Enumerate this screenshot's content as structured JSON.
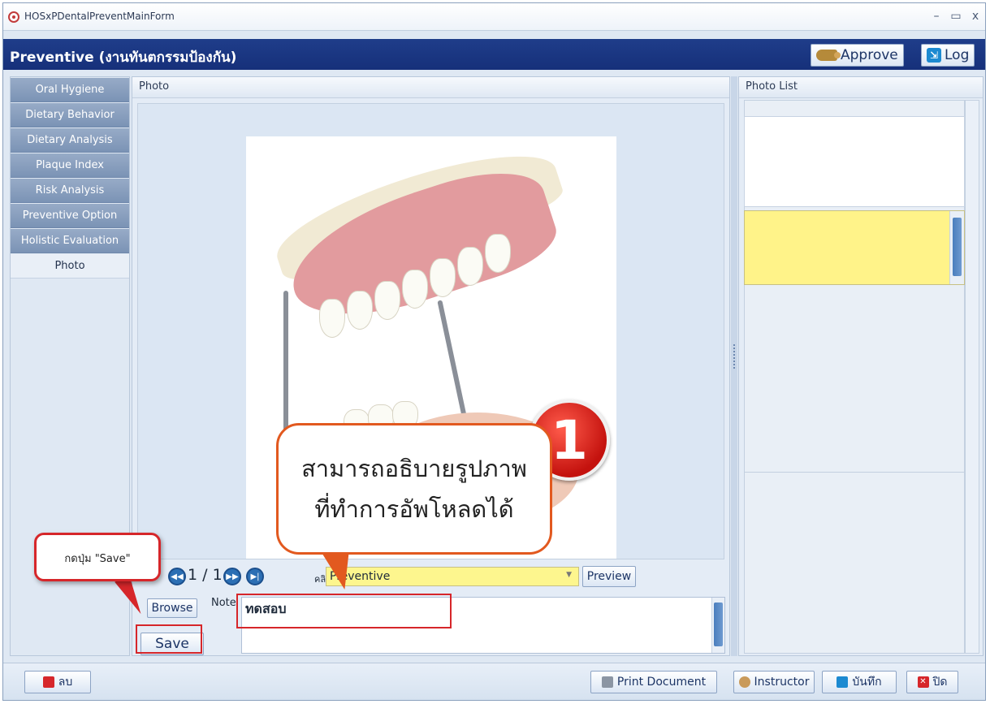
{
  "window": {
    "title": "HOSxPDentalPreventMainForm",
    "controls": [
      "–",
      "▭",
      "x"
    ]
  },
  "header": {
    "title": "Preventive (งานทันตกรรมป้องกัน)",
    "approve_label": "Approve",
    "log_label": "Log"
  },
  "sidebar": {
    "items": [
      {
        "label": "Oral Hygiene"
      },
      {
        "label": "Dietary Behavior"
      },
      {
        "label": "Dietary Analysis"
      },
      {
        "label": "Plaque Index"
      },
      {
        "label": "Risk Analysis"
      },
      {
        "label": "Preventive Option"
      },
      {
        "label": "Holistic Evaluation"
      },
      {
        "label": "Photo"
      }
    ],
    "active_index": 7
  },
  "photo_panel": {
    "header": "Photo",
    "page_indicator": "1 / 1",
    "clinic_label": "คลินิก",
    "clinic_value": "Preventive",
    "preview_label": "Preview",
    "browse_label": "Browse",
    "note_label": "Note",
    "note_value": "ทดสอบ",
    "save_label": "Save"
  },
  "photo_list": {
    "header": "Photo List"
  },
  "annotations": {
    "step_number": "1",
    "callout_line1": "สามารถอธิบายรูปภาพ",
    "callout_line2": "ที่ทำการอัพโหลดได้",
    "save_hint": "กดปุ่ม \"Save\""
  },
  "footer": {
    "delete_label": "ลบ",
    "print_label": "Print Document",
    "instructor_label": "Instructor",
    "save_label": "บันทึก",
    "close_label": "ปิด"
  },
  "colors": {
    "header_bg": "#1f3d8a",
    "sidebar_item": "#8aa0c0",
    "highlight_yellow": "#fff389",
    "annotation_red": "#d6262a",
    "callout_orange": "#e2591f"
  }
}
